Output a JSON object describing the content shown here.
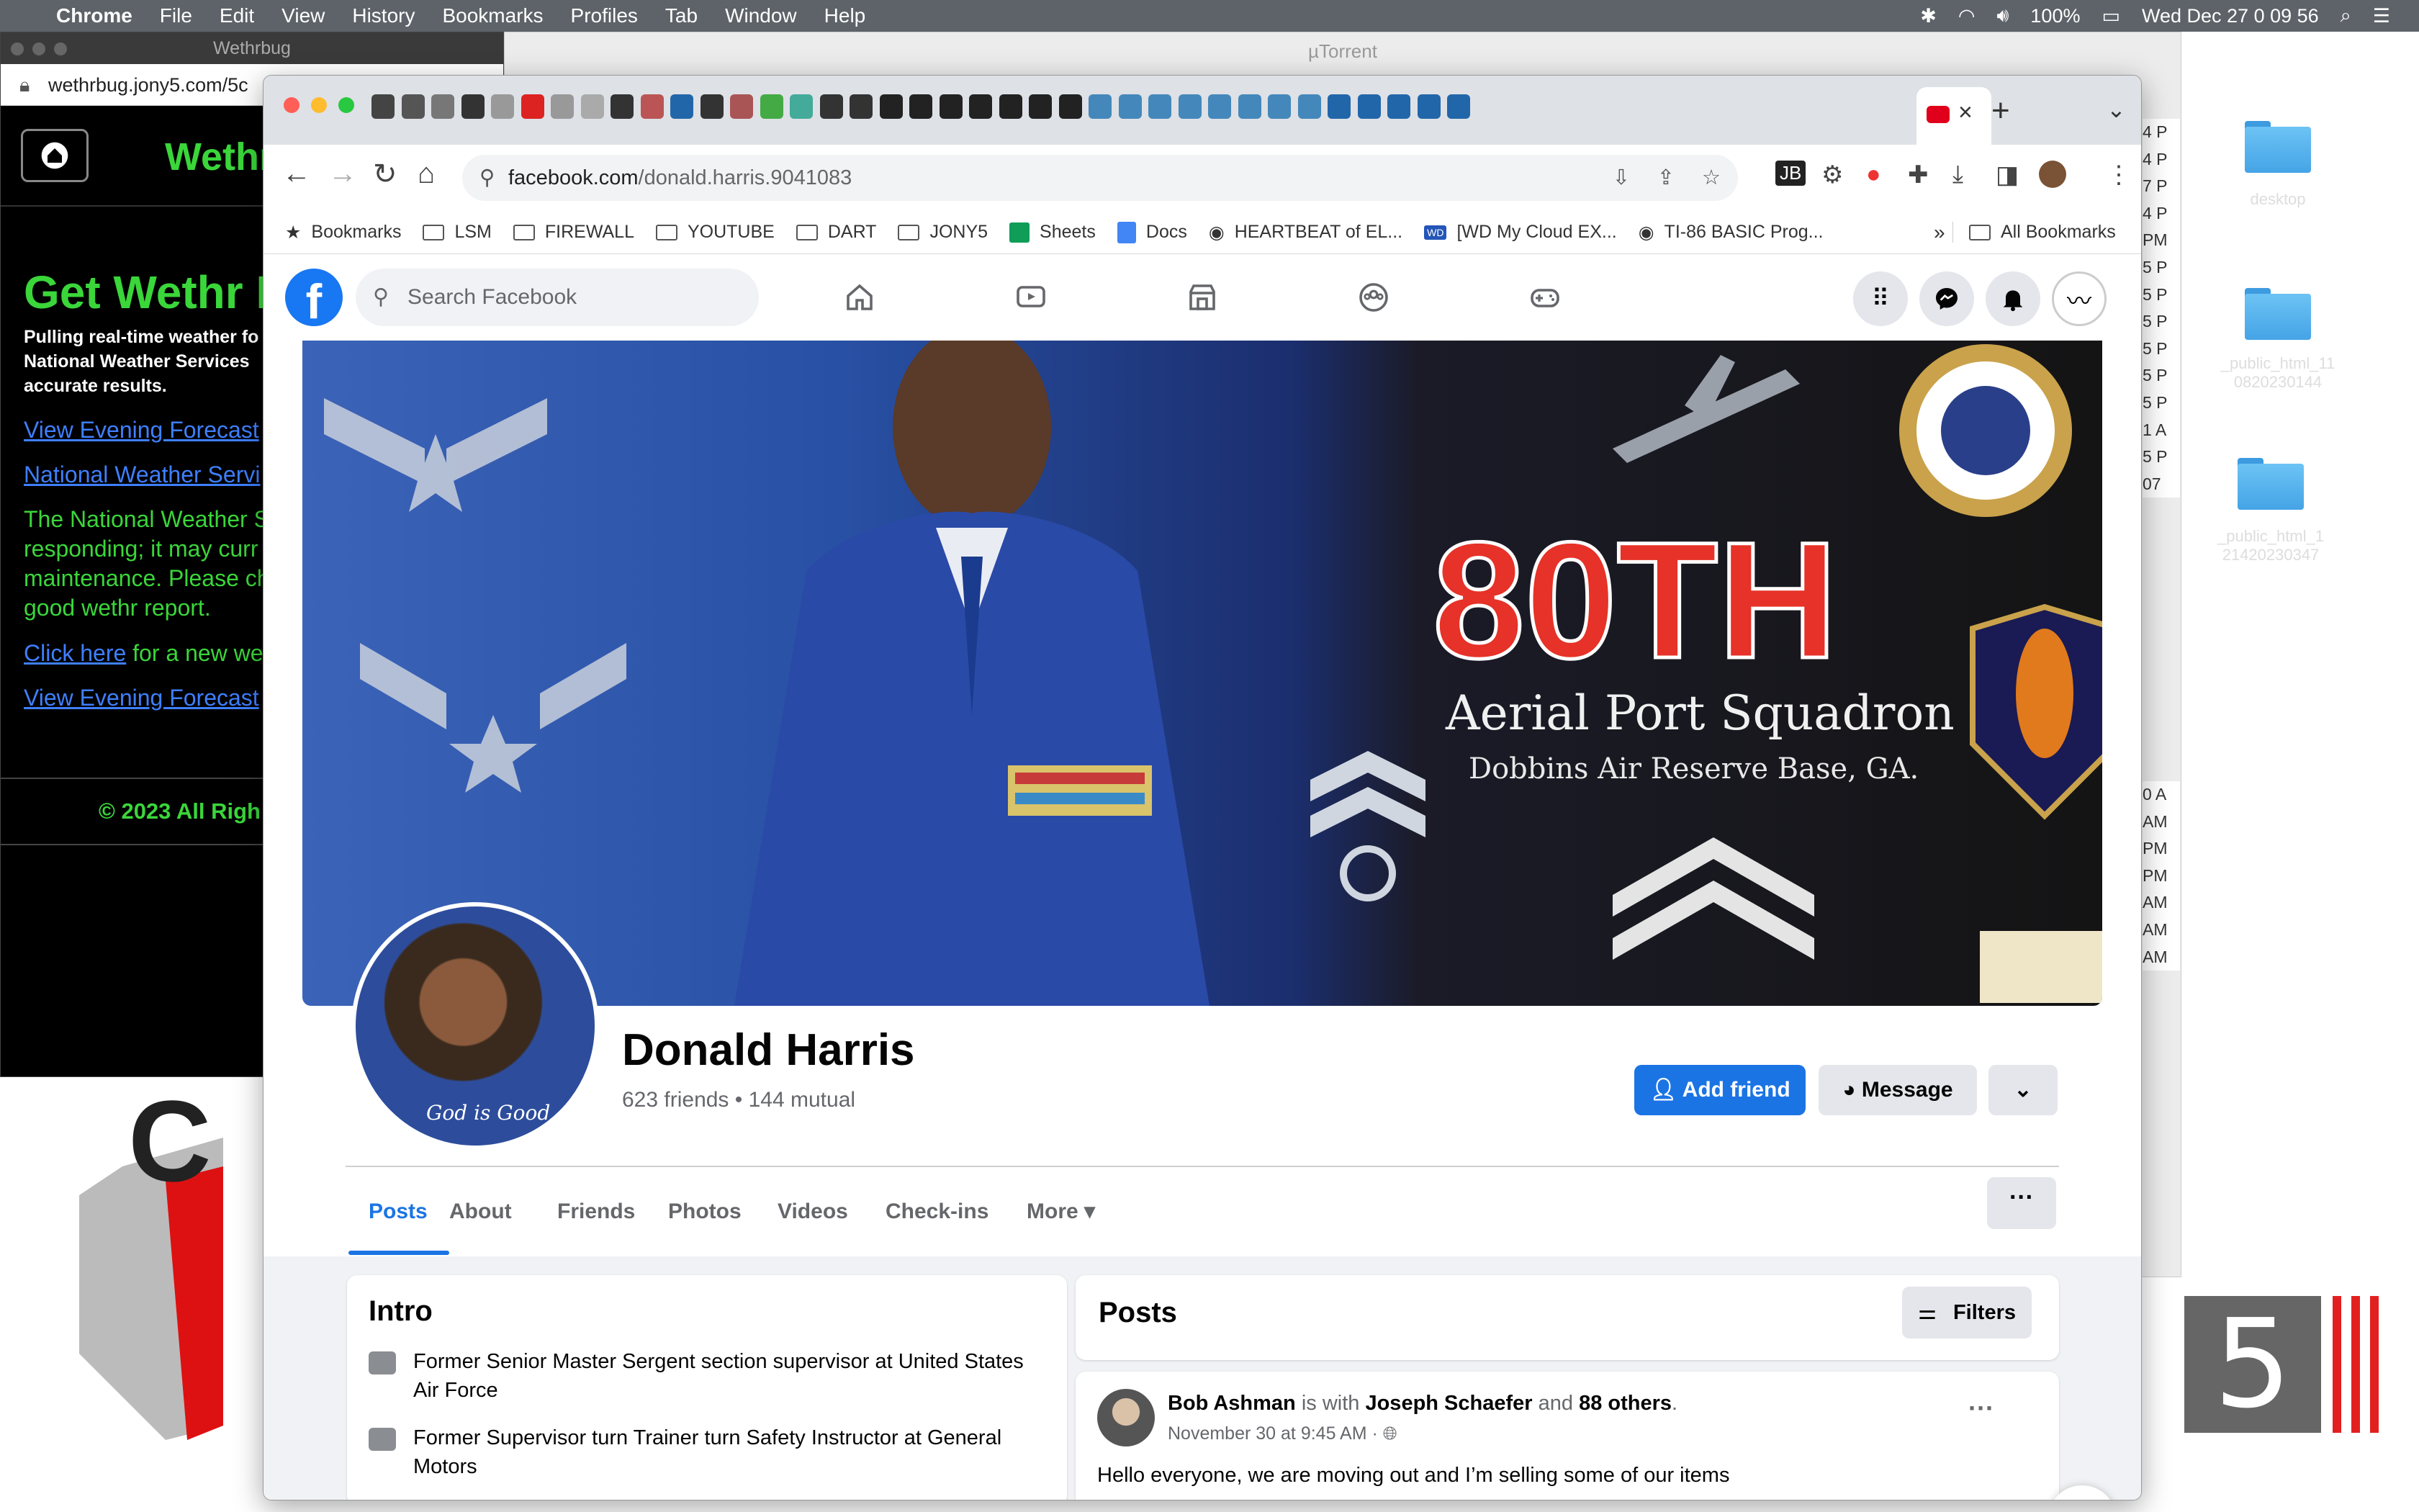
{
  "menubar": {
    "app": "Chrome",
    "items": [
      "File",
      "Edit",
      "View",
      "History",
      "Bookmarks",
      "Profiles",
      "Tab",
      "Window",
      "Help"
    ],
    "battery": "100%",
    "datetime": "Wed Dec 27  0 09 56"
  },
  "desktop": {
    "folders": [
      {
        "label": "desktop"
      },
      {
        "label": "_public_html_11 0820230144"
      },
      {
        "label": "_public_html_1 21420230347"
      }
    ]
  },
  "utorrent": {
    "title": "µTorrent",
    "column_values": [
      "4 P",
      "4 P",
      "7 P",
      "4 P",
      "",
      "PM",
      "5 P",
      "5 P",
      "5 P",
      "5 P",
      "5 P",
      "5 P",
      "1 A",
      "5 P",
      "07",
      "",
      "",
      "",
      "",
      "",
      "0 A",
      "AM",
      "PM",
      "PM",
      "AM",
      "AM",
      "AM"
    ]
  },
  "wethrbug": {
    "window_title": "Wethrbug",
    "url": "wethrbug.jony5.com/5c",
    "brand": "Wethr",
    "heading": "Get Wethr I",
    "intro": "Pulling real-time weather fo National Weather Services accurate results.",
    "link1": "View Evening Forecast",
    "link2": "National Weather Servi",
    "message": "The National Weather S responding; it may curr maintenance. Please ch good wethr report.",
    "click_here": "Click here",
    "click_rest": " for a new we",
    "link3": "View Evening Forecast",
    "footer": "© 2023 All Righ"
  },
  "chrome": {
    "url_domain": "facebook.com",
    "url_path": "/donald.harris.9041083",
    "bookmarks": [
      {
        "label": "Bookmarks",
        "icon": "star-icon"
      },
      {
        "label": "LSM",
        "icon": "folder-icon"
      },
      {
        "label": "FIREWALL",
        "icon": "folder-icon"
      },
      {
        "label": "YOUTUBE",
        "icon": "folder-icon"
      },
      {
        "label": "DART",
        "icon": "folder-icon"
      },
      {
        "label": "JONY5",
        "icon": "folder-icon"
      },
      {
        "label": "Sheets",
        "icon": "sheets-icon"
      },
      {
        "label": "Docs",
        "icon": "docs-icon"
      },
      {
        "label": "HEARTBEAT of EL...",
        "icon": "globe-icon"
      },
      {
        "label": "[WD My Cloud EX...",
        "icon": "wd-icon"
      },
      {
        "label": "TI-86 BASIC Prog...",
        "icon": "globe-icon"
      }
    ],
    "bookmarks_overflow": "»",
    "all_bookmarks": "All Bookmarks"
  },
  "facebook": {
    "search_placeholder": "Search Facebook",
    "cover": {
      "headline": "80TH",
      "line1": "Aerial Port Squadron",
      "line2": "Dobbins Air Reserve Base, GA."
    },
    "avatar_caption": "God is Good",
    "name": "Donald Harris",
    "friends": "623 friends • 144 mutual",
    "add_friend": "Add friend",
    "message": "Message",
    "tabs": [
      "Posts",
      "About",
      "Friends",
      "Photos",
      "Videos",
      "Check-ins",
      "More"
    ],
    "intro_title": "Intro",
    "intro_items": [
      "Former Senior Master Sergent section supervisor at United States Air Force",
      "Former Supervisor turn Trainer turn Safety Instructor at General Motors"
    ],
    "posts_title": "Posts",
    "filters": "Filters",
    "post": {
      "author": "Bob Ashman",
      "with_text": " is with ",
      "tagged": "Joseph Schaefer",
      "and_text": " and ",
      "others": "88 others",
      "time": "November 30 at 9:45 AM · ",
      "text": "Hello everyone, we are moving out and I’m selling some of our  items"
    }
  },
  "colors": {
    "fb_blue": "#1b74e4",
    "wethr_green": "#3ad63a",
    "menubar": "#5d6368"
  }
}
